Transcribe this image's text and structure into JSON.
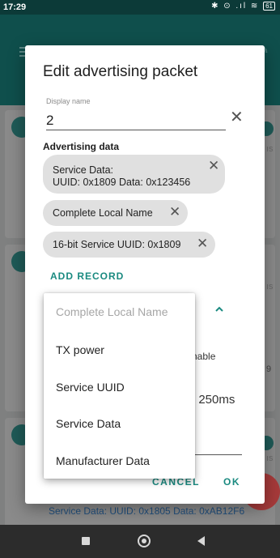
{
  "status_bar": {
    "time": "17:29",
    "icons_text": "✱ ⊙ .ıl ≋",
    "battery": "61"
  },
  "background": {
    "line_text": "Service Data: UUID: 0x1805 Data: 0xAB12F6",
    "side_a": "ıs",
    "side_b": "ıs",
    "side_c": "9",
    "side_d": "ıs"
  },
  "dialog": {
    "title": "Edit advertising packet",
    "display_name_label": "Display name",
    "display_name_value": "2",
    "section_label": "Advertising data",
    "chips": [
      {
        "line1": "Service Data:",
        "line2": "UUID: 0x1809 Data: 0x123456"
      },
      {
        "line1": "Complete Local Name"
      },
      {
        "line1": "16-bit Service UUID: 0x1809"
      }
    ],
    "add_record": "ADD RECORD",
    "behind_text_1": "nable",
    "behind_text_2": ": 250ms",
    "cancel": "CANCEL",
    "ok": "OK"
  },
  "dropdown": {
    "options": [
      {
        "label": "Complete Local Name",
        "disabled": true
      },
      {
        "label": "TX power",
        "disabled": false
      },
      {
        "label": "Service UUID",
        "disabled": false
      },
      {
        "label": "Service Data",
        "disabled": false
      },
      {
        "label": "Manufacturer Data",
        "disabled": false
      }
    ]
  },
  "colors": {
    "accent": "#1a8a80",
    "appbar": "#0f4f4c",
    "chip_bg": "#e0e0e0"
  }
}
